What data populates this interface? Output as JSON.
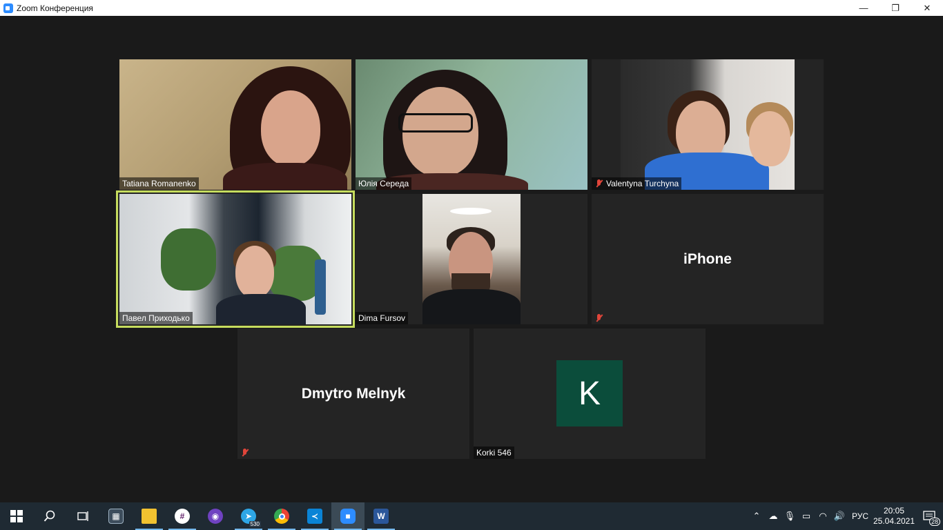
{
  "window": {
    "title": "Zoom Конференция",
    "minimize": "—",
    "maximize": "❐",
    "close": "✕"
  },
  "participants": [
    {
      "name": "Tatiana Romanenko",
      "muted": false,
      "video": true
    },
    {
      "name": "Юлія Середа",
      "muted": false,
      "video": true
    },
    {
      "name": "Valentyna Turchyna",
      "muted": true,
      "video": true
    },
    {
      "name": "Павел Приходько",
      "muted": false,
      "video": true,
      "active_speaker": true
    },
    {
      "name": "Dima Fursov",
      "muted": false,
      "video": true
    },
    {
      "name": "iPhone",
      "muted": true,
      "video": false
    },
    {
      "name": "Dmytro Melnyk",
      "muted": true,
      "video": false
    },
    {
      "name": "Korki 546",
      "muted": false,
      "video": false,
      "avatar_letter": "K"
    }
  ],
  "colors": {
    "active_border": "#c6dd5e",
    "avatar_bg": "#0b4d3b",
    "muted_red": "#e0453a",
    "taskbar": "#1f2a33"
  },
  "taskbar": {
    "apps": [
      {
        "name": "start-icon"
      },
      {
        "name": "search-icon"
      },
      {
        "name": "task-view-icon"
      },
      {
        "name": "calculator-icon"
      },
      {
        "name": "file-explorer-icon"
      },
      {
        "name": "slack-icon"
      },
      {
        "name": "github-desktop-icon"
      },
      {
        "name": "telegram-icon",
        "badge": "530"
      },
      {
        "name": "chrome-icon"
      },
      {
        "name": "vscode-icon"
      },
      {
        "name": "zoom-icon"
      },
      {
        "name": "word-icon"
      }
    ],
    "language": "РУС",
    "time": "20:05",
    "date": "25.04.2021",
    "notifications": "28"
  }
}
